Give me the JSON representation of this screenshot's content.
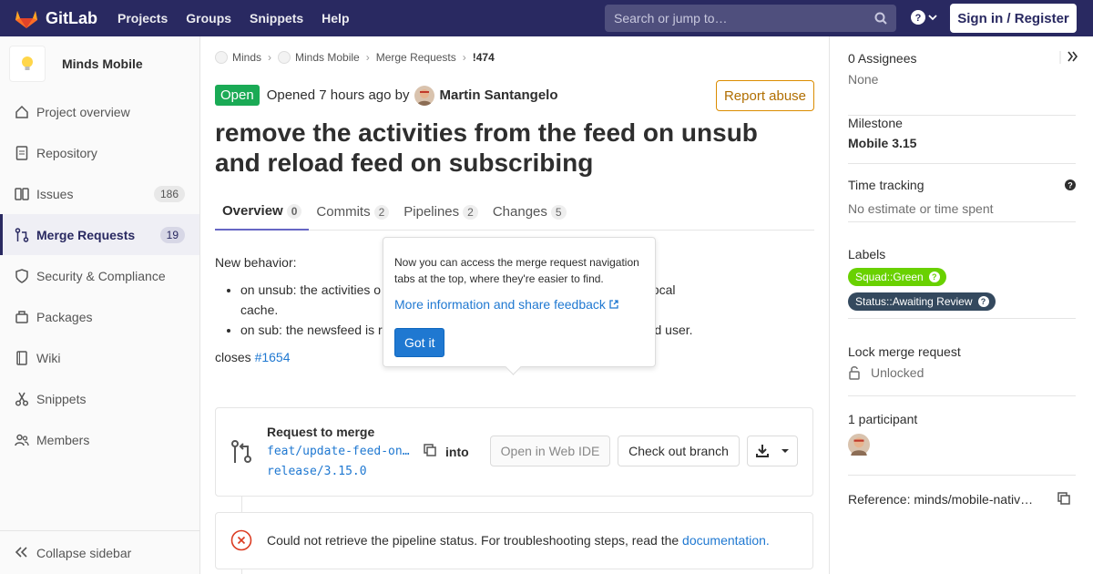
{
  "topbar": {
    "brand": "GitLab",
    "nav": [
      "Projects",
      "Groups",
      "Snippets",
      "Help"
    ],
    "search_placeholder": "Search or jump to…",
    "signin_label": "Sign in / Register"
  },
  "sidebar": {
    "project_name": "Minds Mobile",
    "items": [
      {
        "label": "Project overview",
        "icon": "home-icon",
        "badge": ""
      },
      {
        "label": "Repository",
        "icon": "doc-icon",
        "badge": ""
      },
      {
        "label": "Issues",
        "icon": "issues-icon",
        "badge": "186"
      },
      {
        "label": "Merge Requests",
        "icon": "merge-request-icon",
        "badge": "19",
        "active": true
      },
      {
        "label": "Security & Compliance",
        "icon": "shield-icon",
        "badge": ""
      },
      {
        "label": "Packages",
        "icon": "package-icon",
        "badge": ""
      },
      {
        "label": "Wiki",
        "icon": "book-icon",
        "badge": ""
      },
      {
        "label": "Snippets",
        "icon": "scissors-icon",
        "badge": ""
      },
      {
        "label": "Members",
        "icon": "users-icon",
        "badge": ""
      }
    ],
    "collapse_label": "Collapse sidebar"
  },
  "breadcrumbs": [
    "Minds",
    "Minds Mobile",
    "Merge Requests",
    "!474"
  ],
  "mr": {
    "status": "Open",
    "opened_text": "Opened 7 hours ago by",
    "author": "Martin Santangelo",
    "report_label": "Report abuse",
    "title": "remove the activities from the feed on unsub and reload feed on subscribing",
    "tabs": [
      {
        "label": "Overview",
        "count": "0",
        "active": true
      },
      {
        "label": "Commits",
        "count": "2"
      },
      {
        "label": "Pipelines",
        "count": "2"
      },
      {
        "label": "Changes",
        "count": "5"
      }
    ],
    "description": {
      "heading": "New behavior:",
      "bullet1_start": "on unsub: the activities o",
      "bullet1_end": "pre and from the local",
      "bullet1_line2": "cache.",
      "bullet2_start": "on sub: the newsfeed is r",
      "bullet2_end": "of the subscribed user.",
      "closes_text": "closes",
      "closes_link": "#1654"
    }
  },
  "popover": {
    "text": "Now you can access the merge request navigation tabs at the top, where they're easier to find.",
    "link": "More information and share feedback",
    "button": "Got it"
  },
  "merge_box": {
    "label": "Request to merge",
    "source_branch": "feat/update-feed-on…",
    "into": "into",
    "target_branch": "release/3.15.0",
    "web_ide": "Open in Web IDE",
    "checkout": "Check out branch"
  },
  "pipeline": {
    "text": "Could not retrieve the pipeline status. For troubleshooting steps, read the",
    "link": "documentation."
  },
  "right_sidebar": {
    "assignees_title": "0 Assignees",
    "assignees_value": "None",
    "milestone_title": "Milestone",
    "milestone_value": "Mobile 3.15",
    "time_title": "Time tracking",
    "time_value": "No estimate or time spent",
    "labels_title": "Labels",
    "labels": [
      {
        "name": "Squad::Green",
        "color": "#69d100"
      },
      {
        "name": "Status::Awaiting Review",
        "color": "#34495e"
      }
    ],
    "lock_title": "Lock merge request",
    "lock_value": "Unlocked",
    "participants_title": "1 participant",
    "reference": "Reference: minds/mobile-nativ…"
  }
}
